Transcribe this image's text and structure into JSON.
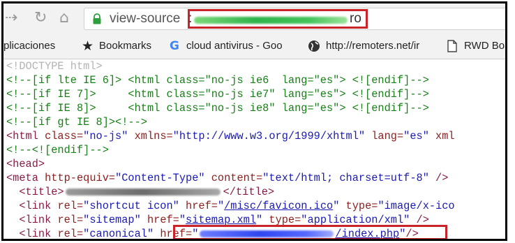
{
  "browser": {
    "url_scheme": "view-source",
    "url_colon": ":",
    "url_tail": "ro",
    "colors": {
      "highlight": "#c9242a",
      "toolbar_bg": "#f2f2f2"
    }
  },
  "bookmarks": [
    {
      "label": "plicaciones",
      "icon": "apps-icon"
    },
    {
      "label": "Bookmarks",
      "icon": "star-icon"
    },
    {
      "label": "cloud antivirus - Goo",
      "icon": "google-g-icon"
    },
    {
      "label": "http://remoters.net/ir",
      "icon": "globe-icon"
    },
    {
      "label": "RWD Bo",
      "icon": "page-icon"
    }
  ],
  "source": {
    "l1": "<!DOCTYPE html>",
    "l2": "<!--[if lte IE 6]> <html class=\"no-js ie6  lang=\"es\"> <![endif]-->",
    "l3": "<!--[if IE 7]>     <html class=\"no-js ie7\" lang=\"es\"> <![endif]-->",
    "l4": "<!--[if IE 8]>     <html class=\"no-js ie8\" lang=\"es\"> <![endif]-->",
    "l5": "<!--[if gt IE 8]><!-->",
    "l6": {
      "tag_open": "<html ",
      "a1": "class=",
      "v1": "\"no-js\"",
      "a2": " xmlns=",
      "v2": "\"http://www.w3.org/1999/xhtml\"",
      "a3": " lang=",
      "v3": "\"es\"",
      "rest": " xml"
    },
    "l7": "<!--<![endif]-->",
    "l8": "<head>",
    "l9": {
      "tag_open": "<meta ",
      "a1": "http-equiv=",
      "v1": "\"Content-Type\"",
      "a2": " content=",
      "v2": "\"text/html; charset=utf-8\"",
      "tag_close": " />"
    },
    "l10": {
      "indent": "  ",
      "tag_open": "<title>",
      "tag_close": "</title>"
    },
    "l11": {
      "indent": "  ",
      "tag_open": "<link ",
      "a1": "rel=",
      "v1": "\"shortcut icon\"",
      "a2": " href=",
      "q_open": "\"",
      "link": "/misc/favicon.ico",
      "q_close": "\"",
      "a3": " type=",
      "v3": "\"image/x-ico"
    },
    "l12": {
      "indent": "  ",
      "tag_open": "<link ",
      "a1": "rel=",
      "v1": "\"sitemap\"",
      "a2": " href=",
      "q_open": "\"",
      "link": "sitemap.xml",
      "q_close": "\"",
      "a3": " type=",
      "v3": "\"application/xml\"",
      "tag_close": " />"
    },
    "l13": {
      "indent": "  ",
      "tag_open": "<link ",
      "a1": "rel=",
      "v1": "\"canonical\"",
      "a2": " href=",
      "q_open": "\"",
      "link": "/index.php",
      "q_close": "\"",
      "tag_close": "/>"
    }
  }
}
